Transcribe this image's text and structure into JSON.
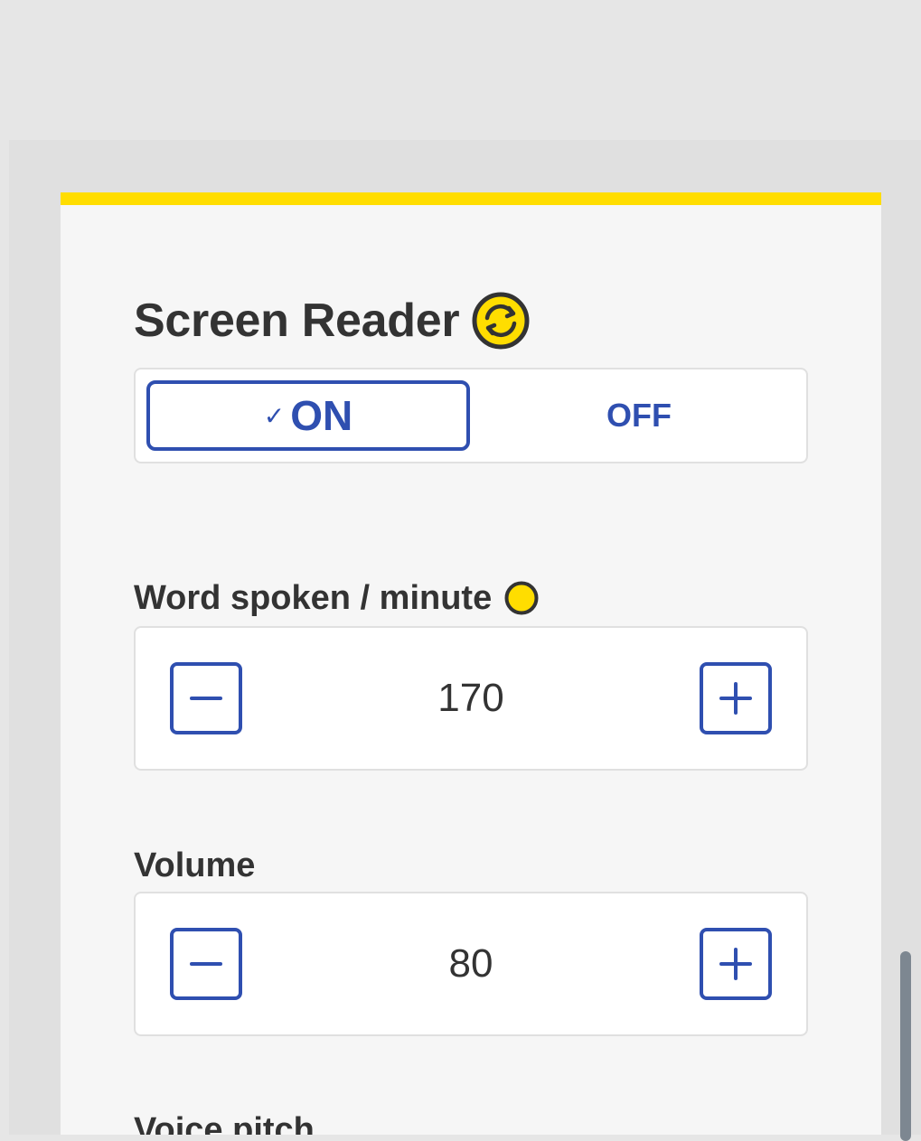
{
  "screen_reader": {
    "title": "Screen Reader",
    "title_icon": "sync-icon",
    "toggle": {
      "on_label": "ON",
      "off_label": "OFF",
      "selected": "ON"
    }
  },
  "fields": {
    "words_per_minute": {
      "label": "Word spoken / minute",
      "indicator_icon": "status-dot-icon",
      "value": "170"
    },
    "volume": {
      "label": "Volume",
      "value": "80"
    },
    "voice_pitch": {
      "label": "Voice pitch"
    }
  },
  "colors": {
    "accent_yellow": "#ffdd00",
    "primary_blue": "#2f4fb0",
    "text_dark": "#333333",
    "scrollbar": "#7d8791"
  }
}
